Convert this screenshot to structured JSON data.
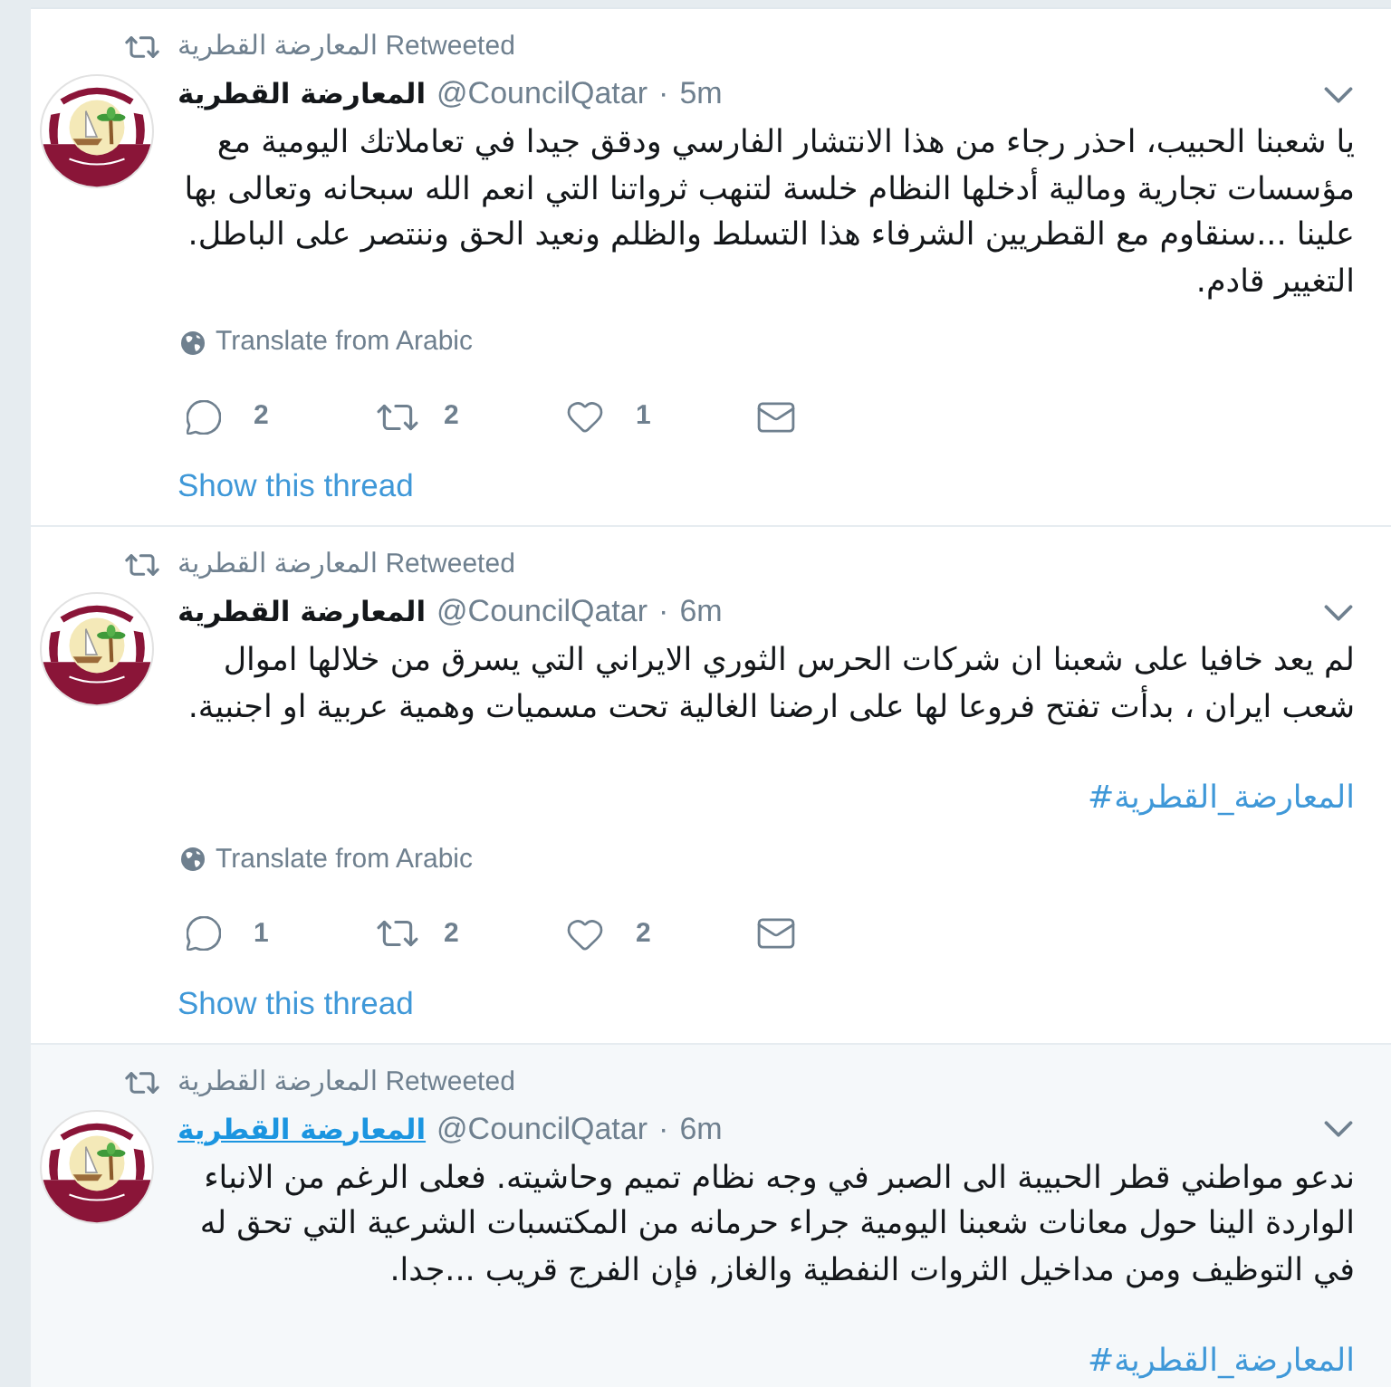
{
  "tweets": [
    {
      "hovered": false,
      "context": "المعارضة القطرية Retweeted",
      "author": {
        "name": "المعارضة القطرية",
        "handle": "@CouncilQatar",
        "dot": "·",
        "time": "5m"
      },
      "text": "يا شعبنا الحبيب، احذر رجاء من هذا الانتشار الفارسي ودقق جيدا في تعاملاتك اليومية مع مؤسسات تجارية ومالية أدخلها النظام خلسة لتنهب ثرواتنا التي انعم الله سبحانه وتعالى بها علينا ...سنقاوم مع القطريين الشرفاء هذا التسلط والظلم ونعيد الحق وننتصر على الباطل. التغيير قادم.",
      "translate": "Translate from Arabic",
      "actions": {
        "reply": "2",
        "retweet": "2",
        "like": "1"
      },
      "thread_link": "Show this thread"
    },
    {
      "hovered": false,
      "context": "المعارضة القطرية Retweeted",
      "author": {
        "name": "المعارضة القطرية",
        "handle": "@CouncilQatar",
        "dot": "·",
        "time": "6m"
      },
      "text": "لم يعد خافيا على شعبنا ان شركات الحرس الثوري الايراني التي يسرق من خلالها اموال شعب ايران ، بدأت تفتح فروعا لها على ارضنا الغالية تحت مسميات وهمية عربية او اجنبية.",
      "hashtag": "#المعارضة_القطرية",
      "translate": "Translate from Arabic",
      "actions": {
        "reply": "1",
        "retweet": "2",
        "like": "2"
      },
      "thread_link": "Show this thread"
    },
    {
      "hovered": true,
      "context": "المعارضة القطرية Retweeted",
      "author": {
        "name": "المعارضة القطرية",
        "handle": "@CouncilQatar",
        "dot": "·",
        "time": "6m"
      },
      "text": "ندعو مواطني قطر الحبيبة الى الصبر في وجه نظام تميم وحاشيته. فعلى الرغم من الانباء الواردة الينا حول معانات شعبنا اليومية جراء حرمانه من المكتسبات الشرعية التي تحق له في التوظيف ومن مداخيل الثروات النفطية والغاز, فإن الفرج قريب ...جدا.",
      "hashtag": "#المعارضة_القطرية"
    }
  ]
}
